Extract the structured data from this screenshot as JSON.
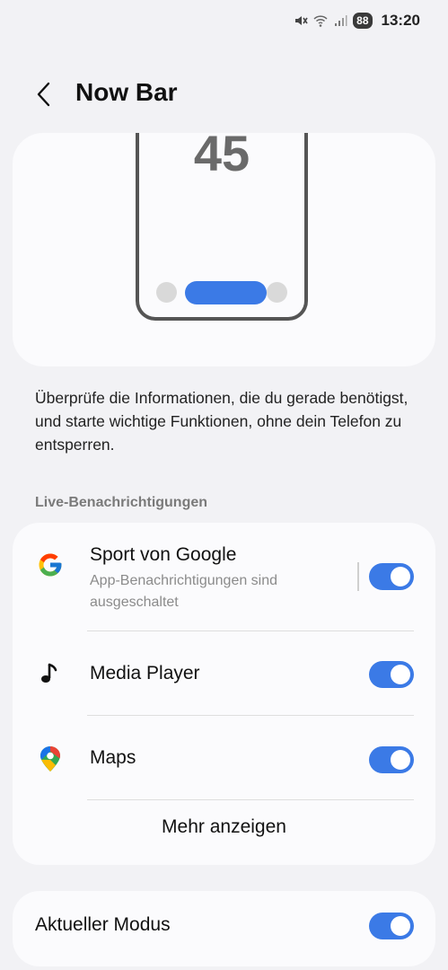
{
  "status_bar": {
    "battery": "88",
    "time": "13:20",
    "icons": [
      "mute-icon",
      "wifi-icon",
      "signal-icon"
    ]
  },
  "header": {
    "title": "Now Bar"
  },
  "hero": {
    "phone_number": "45"
  },
  "description": "Überprüfe die Informationen, die du gerade benötigst, und starte wichtige Funktionen, ohne dein Telefon zu entsperren.",
  "section": {
    "label": "Live-Benachrichtigungen"
  },
  "items": [
    {
      "title": "Sport von Google",
      "subtitle": "App-Benachrichtigungen sind ausgeschaltet",
      "icon": "google-icon",
      "enabled": true
    },
    {
      "title": "Media Player",
      "icon": "music-note-icon",
      "enabled": true
    },
    {
      "title": "Maps",
      "icon": "maps-icon",
      "enabled": true
    }
  ],
  "more_label": "Mehr anzeigen",
  "mode": {
    "label": "Aktueller Modus",
    "enabled": true
  },
  "colors": {
    "accent": "#3b7ae6",
    "background": "#f2f2f5",
    "card": "#fbfbfd"
  }
}
